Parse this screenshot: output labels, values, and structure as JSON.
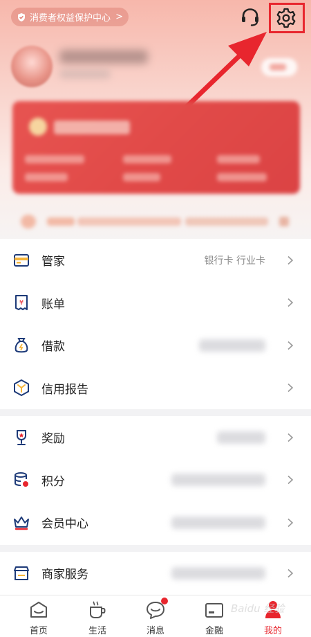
{
  "header": {
    "consumer_pill": "消费者权益保护中心",
    "consumer_chevron": ">"
  },
  "menu": {
    "section1": [
      {
        "label": "管家",
        "value": "银行卡 行业卡"
      },
      {
        "label": "账单",
        "value": ""
      },
      {
        "label": "借款",
        "value": ""
      },
      {
        "label": "信用报告",
        "value": ""
      }
    ],
    "section2": [
      {
        "label": "奖励",
        "value": ""
      },
      {
        "label": "积分",
        "value": ""
      },
      {
        "label": "会员中心",
        "value": ""
      }
    ],
    "section3": [
      {
        "label": "商家服务",
        "value": ""
      }
    ]
  },
  "nav": {
    "tabs": [
      {
        "label": "首页",
        "icon": "home-icon"
      },
      {
        "label": "生活",
        "icon": "cup-icon"
      },
      {
        "label": "消息",
        "icon": "message-icon"
      },
      {
        "label": "金融",
        "icon": "wallet-icon"
      },
      {
        "label": "我的",
        "icon": "profile-icon"
      }
    ]
  },
  "colors": {
    "accent": "#e8262e",
    "annotation": "#e8262e"
  },
  "watermark": "Baidu 经验"
}
